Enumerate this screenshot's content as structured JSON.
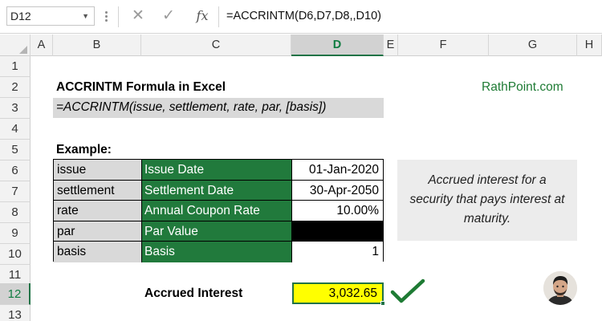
{
  "formula_bar": {
    "name_box": "D12",
    "cancel_icon": "✕",
    "enter_icon": "✓",
    "fx_icon": "fx",
    "formula": "=ACCRINTM(D6,D7,D8,,D10)"
  },
  "columns": [
    "A",
    "B",
    "C",
    "D",
    "E",
    "F",
    "G",
    "H"
  ],
  "active_column": "D",
  "rows": [
    "1",
    "2",
    "3",
    "4",
    "5",
    "6",
    "7",
    "8",
    "9",
    "10",
    "11",
    "12",
    "13"
  ],
  "active_row": "12",
  "sheet": {
    "title": "ACCRINTM Formula in Excel",
    "brand": "RathPoint.com",
    "syntax": "=ACCRINTM(issue, settlement, rate, par, [basis])",
    "example_label": "Example:",
    "table": [
      {
        "arg": "issue",
        "description": "Issue Date",
        "value": "01-Jan-2020"
      },
      {
        "arg": "settlement",
        "description": "Settlement Date",
        "value": "30-Apr-2050"
      },
      {
        "arg": "rate",
        "description": "Annual Coupon Rate",
        "value": "10.00%"
      },
      {
        "arg": "par",
        "description": "Par Value",
        "value": ""
      },
      {
        "arg": "basis",
        "description": "Basis",
        "value": "1"
      }
    ],
    "result_label": "Accrued Interest",
    "result_value": "3,032.65",
    "note": "Accrued interest for a security that pays interest at maturity."
  },
  "colors": {
    "green_fill": "#217a3c",
    "gray_fill": "#d9d9d9",
    "result_fill": "#ffff00",
    "brand_text": "#1e7b34",
    "check": "#1e7b34",
    "selection": "#217346"
  },
  "icons": {
    "check": "checkmark-icon",
    "avatar": "author-avatar"
  }
}
